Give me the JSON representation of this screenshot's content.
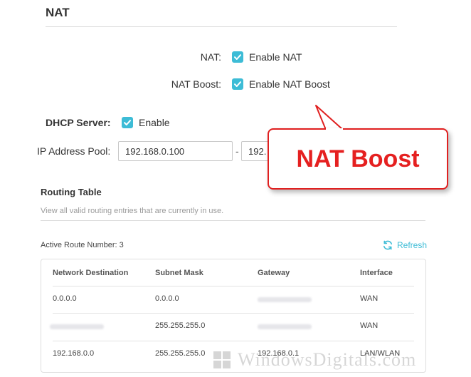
{
  "nat_section": {
    "title": "NAT",
    "nat_label": "NAT:",
    "nat_checkbox_label": "Enable NAT",
    "nat_boost_label": "NAT Boost:",
    "nat_boost_checkbox_label": "Enable NAT Boost"
  },
  "dhcp": {
    "label": "DHCP Server:",
    "checkbox_label": "Enable",
    "pool_label": "IP Address Pool:",
    "pool_start": "192.168.0.100",
    "pool_separator": "-",
    "pool_end": "192."
  },
  "callout": {
    "text": "NAT Boost",
    "color": "#e52020"
  },
  "routing_table": {
    "title": "Routing Table",
    "description": "View all valid routing entries that are currently in use.",
    "active_route": "Active Route Number: 3",
    "refresh_label": "Refresh",
    "refresh_icon": "refresh-icon",
    "columns": [
      "Network Destination",
      "Subnet Mask",
      "Gateway",
      "Interface"
    ],
    "rows": [
      [
        "0.0.0.0",
        "0.0.0.0",
        "",
        "WAN"
      ],
      [
        "",
        "255.255.255.0",
        "",
        "WAN"
      ],
      [
        "192.168.0.0",
        "255.255.255.0",
        "192.168.0.1",
        "LAN/WLAN"
      ]
    ]
  },
  "watermark": {
    "text": "WindowsDigitals.com"
  },
  "colors": {
    "accent": "#3dbcd6",
    "callout_border": "#e02020"
  }
}
